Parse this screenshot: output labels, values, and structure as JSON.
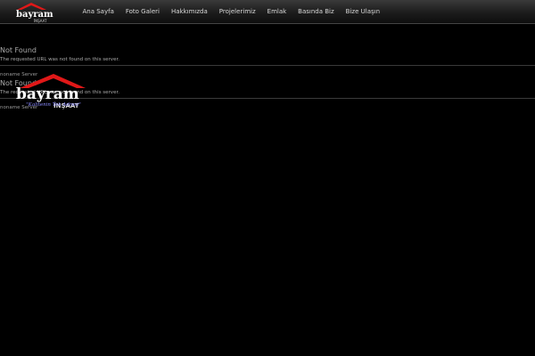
{
  "header": {
    "logo_icon": "bayram-insaat-logo",
    "nav": [
      {
        "label": "Ana Sayfa"
      },
      {
        "label": "Foto Galeri"
      },
      {
        "label": "Hakkımızda"
      },
      {
        "label": "Projelerimiz"
      },
      {
        "label": "Emlak"
      },
      {
        "label": "Basında Biz"
      },
      {
        "label": "Bize Ulaşın"
      }
    ]
  },
  "errors": [
    {
      "title": "Not Found",
      "message": "The requested URL was not found on this server.",
      "server": "noname Server"
    },
    {
      "title": "Not Found",
      "message": "The requested URL was not found on this server.",
      "server": "noname Server"
    }
  ],
  "logo": {
    "brand": "bayram",
    "sub": "İNŞAAT",
    "slogan": "\"Kalitenin Tek Adresi\""
  },
  "colors": {
    "roof": "#e01818",
    "brand_text": "#ffffff",
    "slogan": "#8a8aff",
    "background": "#000000"
  }
}
